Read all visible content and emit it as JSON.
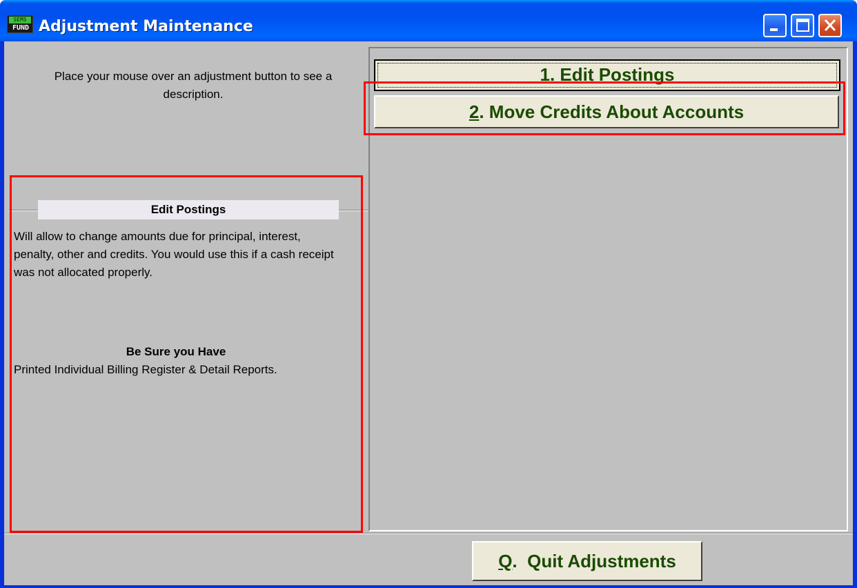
{
  "window": {
    "title": "Adjustment Maintenance",
    "app_icon_top": "SEMS",
    "app_icon_bottom": "FUND",
    "controls": [
      "minimize-icon",
      "maximize-icon",
      "close-icon"
    ]
  },
  "left_pane": {
    "hint": "Place your mouse over an adjustment button to see a description.",
    "description": {
      "title": "Edit Postings",
      "body": "Will allow to change amounts due for principal, interest, penalty, other and credits.  You would use this if a cash receipt was not allocated properly.",
      "sure_title": "Be Sure you Have",
      "sure_body": "Printed Individual Billing Register & Detail Reports."
    }
  },
  "buttons": {
    "edit_postings": {
      "key": "1",
      "rest": ". Edit Postings"
    },
    "move_credits": {
      "key": "2",
      "rest": ". Move Credits About Accounts"
    },
    "quit": {
      "key": "Q",
      "rest": ".  Quit Adjustments"
    }
  },
  "colors": {
    "titlebar": "#0054e3",
    "client": "#c0c0c0",
    "button_text": "#1a4b00",
    "highlight_frame": "#ff0000"
  }
}
